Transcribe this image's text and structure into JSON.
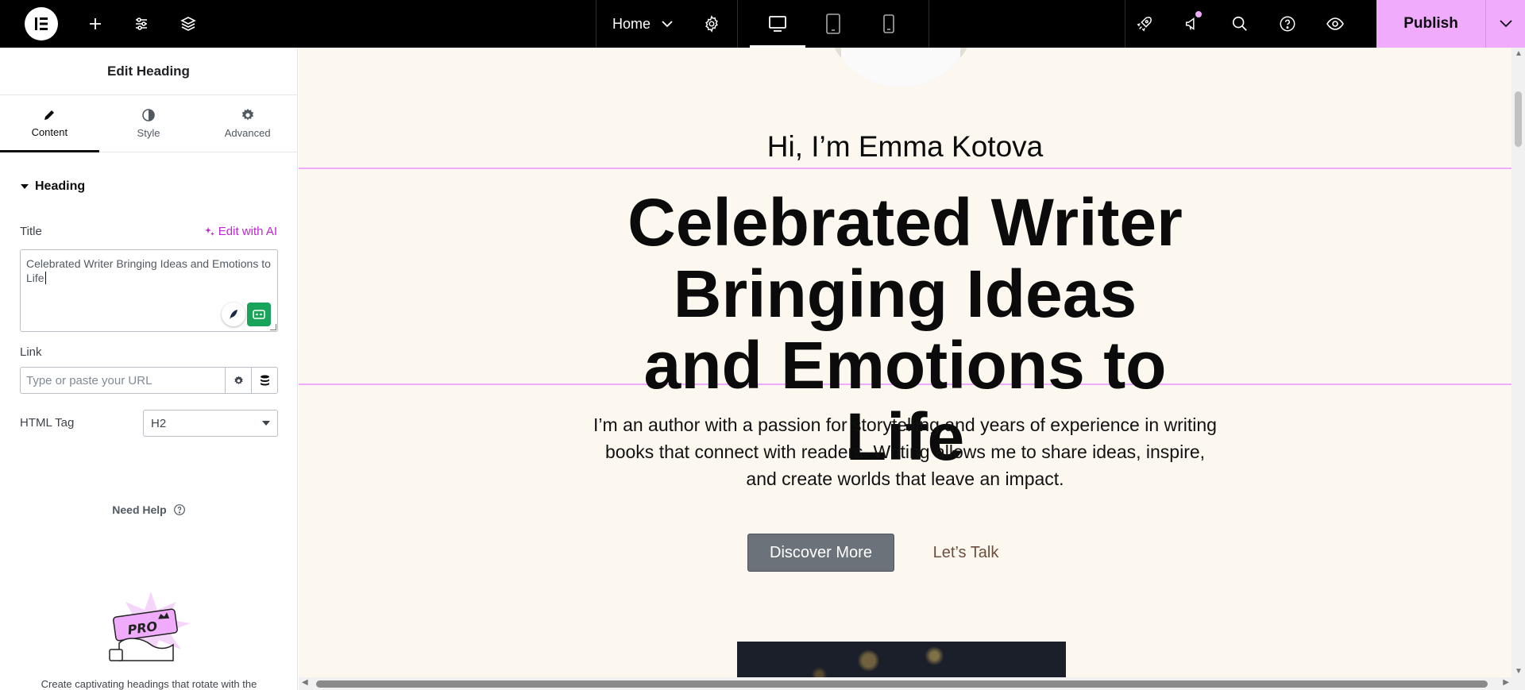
{
  "topbar": {
    "icons": [
      "elementor-logo-icon",
      "add-element-icon",
      "settings-sliders-icon",
      "layers-icon",
      "page-settings-gear-icon",
      "desktop-icon",
      "tablet-icon",
      "mobile-icon",
      "rocket-icon",
      "announcements-icon",
      "search-icon",
      "help-icon",
      "preview-eye-icon",
      "chevron-down-icon"
    ],
    "page_name": "Home",
    "publish_label": "Publish"
  },
  "panel": {
    "title": "Edit Heading",
    "tabs": [
      {
        "label": "Content",
        "icon": "pencil-icon"
      },
      {
        "label": "Style",
        "icon": "half-circle-icon"
      },
      {
        "label": "Advanced",
        "icon": "gear-icon"
      }
    ],
    "section": "Heading",
    "title_label": "Title",
    "edit_ai_label": "Edit with AI",
    "title_value": "Celebrated Writer Bringing Ideas and Emotions to Life",
    "link_label": "Link",
    "link_placeholder": "Type or paste your URL",
    "html_tag_label": "HTML Tag",
    "html_tag_value": "H2",
    "need_help": "Need Help",
    "promo_text": "Create captivating headings that rotate with the",
    "promo_badge": "PRO"
  },
  "canvas": {
    "greeting": "Hi, I’m Emma Kotova",
    "heading": "Celebrated Writer Bringing Ideas and Emotions to Life",
    "paragraph": "I’m an author with a passion for storytelling and years of experience in writing books that connect with readers. Writing allows me to share ideas, inspire, and create worlds that leave an impact.",
    "primary_button": "Discover More",
    "secondary_button": "Let’s Talk"
  },
  "colors": {
    "accent": "#f0abfc",
    "canvas_bg": "#fcf8f0",
    "button_bg": "#6b727a",
    "ai_link": "#c026d3"
  }
}
